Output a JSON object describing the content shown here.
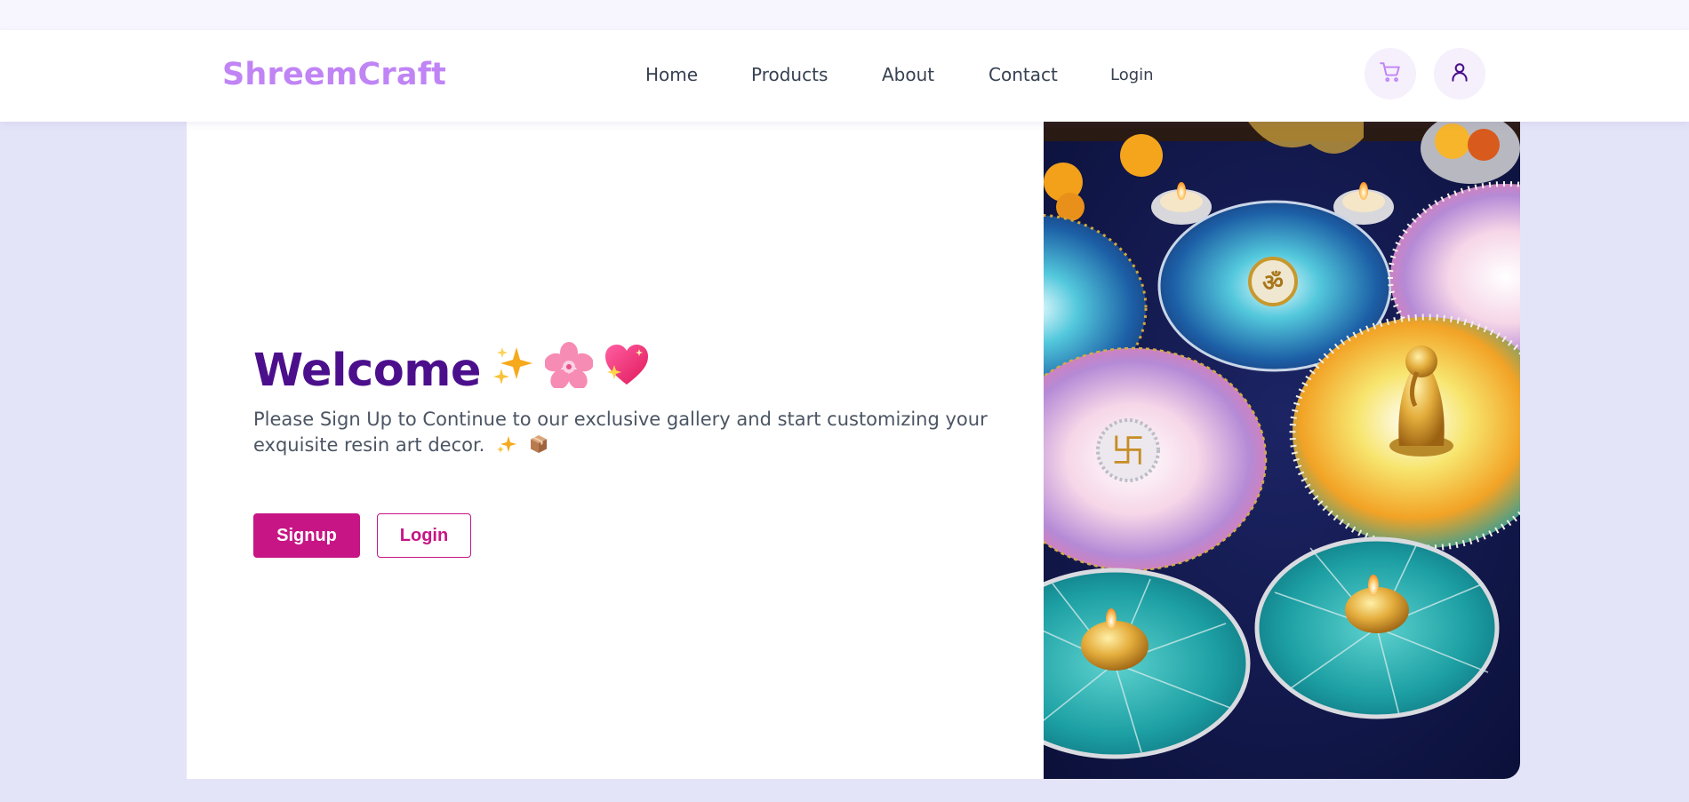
{
  "header": {
    "brand": "ShreemCraft",
    "nav": {
      "home": "Home",
      "products": "Products",
      "about": "About",
      "contact": "Contact",
      "login": "Login"
    },
    "icons": {
      "cart": "shopping-cart-icon",
      "user": "user-profile-icon"
    }
  },
  "hero": {
    "title": "Welcome",
    "subtitle": "Please Sign Up to Continue to our exclusive gallery and start customizing your exquisite resin art decor.",
    "signup_label": "Signup",
    "login_label": "Login",
    "image_icon": "resin-art-decor-image"
  },
  "colors": {
    "brand": "#c084f5",
    "title": "#4c0f8c",
    "accent": "#c71585",
    "page_bg": "#e4e4f8"
  }
}
